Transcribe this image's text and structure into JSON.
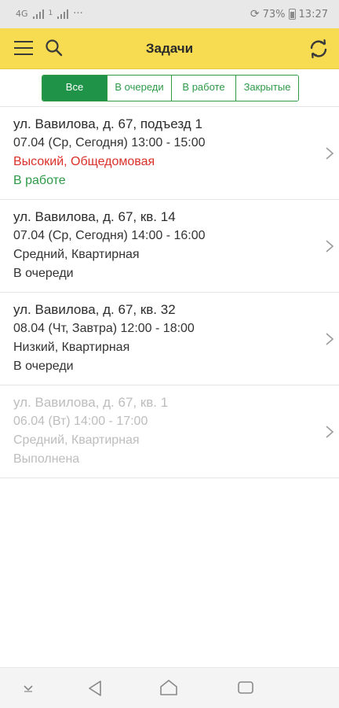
{
  "status_bar": {
    "network": "4G",
    "sim_tag": "1",
    "more": "···",
    "battery": "73%",
    "time": "13:27"
  },
  "app_bar": {
    "title": "Задачи",
    "icons": [
      "menu-icon",
      "search-icon",
      "refresh-icon"
    ]
  },
  "filter_tabs": [
    {
      "label": "Все",
      "active": true
    },
    {
      "label": "В очереди",
      "active": false
    },
    {
      "label": "В работе",
      "active": false
    },
    {
      "label": "Закрытые",
      "active": false
    }
  ],
  "tasks": [
    {
      "address": "ул. Вавилова, д. 67, подъезд 1",
      "datetime": "07.04 (Ср, Сегодня)  13:00 - 15:00",
      "category": "Высокий, Общедомовая",
      "status": "В работе"
    },
    {
      "address": "ул. Вавилова, д. 67, кв. 14",
      "datetime": "07.04 (Ср, Сегодня)  14:00 - 16:00",
      "category": "Средний, Квартирная",
      "status": "В очереди"
    },
    {
      "address": "ул. Вавилова, д. 67, кв. 32",
      "datetime": "08.04 (Чт, Завтра)  12:00 - 18:00",
      "category": "Низкий, Квартирная",
      "status": "В очереди"
    },
    {
      "address": "ул. Вавилова, д. 67, кв. 1",
      "datetime": "06.04 (Вт)  14:00 - 17:00",
      "category": "Средний, Квартирная",
      "status": "Выполнена"
    }
  ],
  "colors": {
    "app_bar": "#f7dc52",
    "accent_green": "#1f9448",
    "priority_high": "#d9302a",
    "completed_text": "#bdbdbd"
  }
}
